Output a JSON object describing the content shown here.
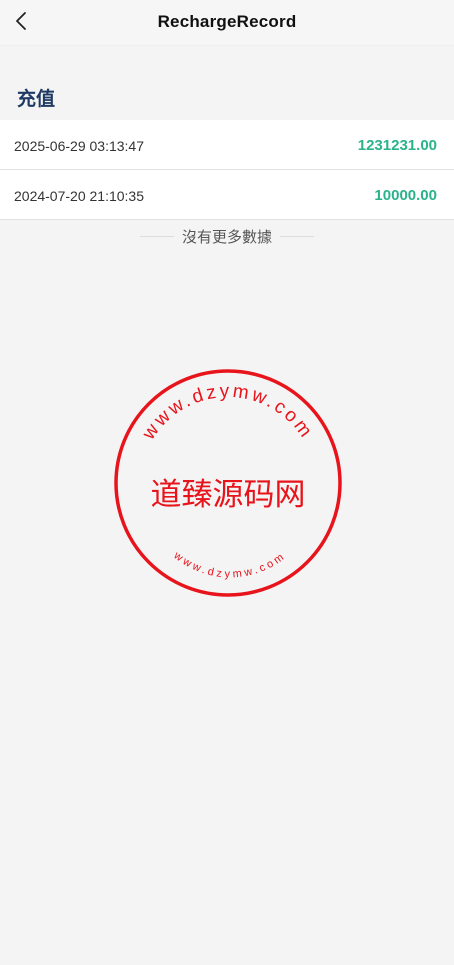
{
  "header": {
    "title": "RechargeRecord",
    "back_icon": "chevron-left-icon"
  },
  "section": {
    "title": "充值"
  },
  "records": [
    {
      "time": "2025-06-29 03:13:47",
      "amount": "1231231.00"
    },
    {
      "time": "2024-07-20 21:10:35",
      "amount": "10000.00"
    }
  ],
  "footer": {
    "no_more": "沒有更多數據"
  },
  "watermark": {
    "center_text": "道臻源码网",
    "ring_text_top": "www.dzymw.com",
    "ring_text_bottom": "www.dzymw.com"
  },
  "colors": {
    "amount": "#2ab38a",
    "section_title": "#1f3a63",
    "seal": "#e8141b"
  }
}
